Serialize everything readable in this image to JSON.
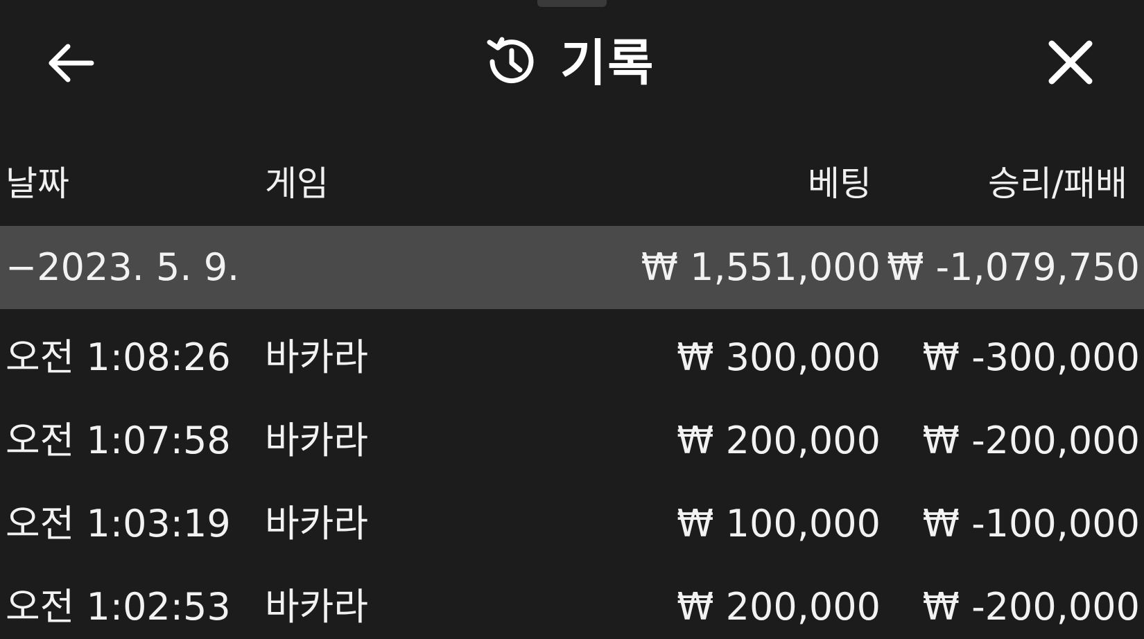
{
  "header": {
    "title": "기록",
    "back_icon": "arrow-left-icon",
    "history_icon": "history-clock-icon",
    "close_icon": "close-icon"
  },
  "columns": {
    "date": "날짜",
    "game": "게임",
    "bet": "베팅",
    "result": "승리/패배"
  },
  "summary": {
    "date": "−2023. 5. 9.",
    "bet": "₩ 1,551,000",
    "result": "₩ -1,079,750"
  },
  "rows": [
    {
      "time": "오전 1:08:26",
      "game": "바카라",
      "bet": "₩ 300,000",
      "result": "₩ -300,000"
    },
    {
      "time": "오전 1:07:58",
      "game": "바카라",
      "bet": "₩ 200,000",
      "result": "₩ -200,000"
    },
    {
      "time": "오전 1:03:19",
      "game": "바카라",
      "bet": "₩ 100,000",
      "result": "₩ -100,000"
    },
    {
      "time": "오전 1:02:53",
      "game": "바카라",
      "bet": "₩ 200,000",
      "result": "₩ -200,000"
    }
  ],
  "colors": {
    "background": "#1c1c1c",
    "summary_row": "#4a4a4a",
    "text": "#f2f2f2"
  }
}
